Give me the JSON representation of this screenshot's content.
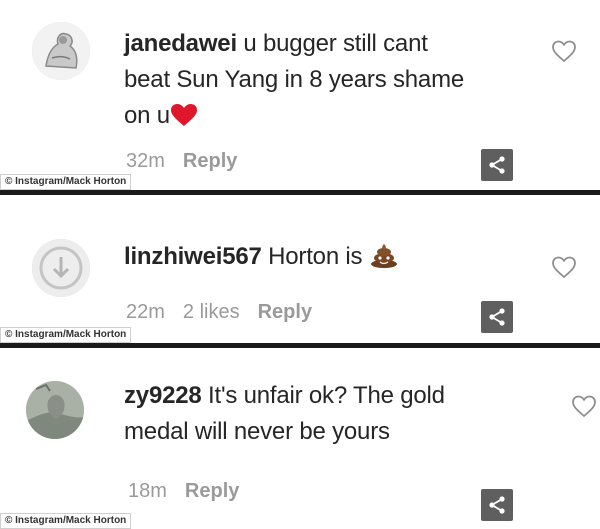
{
  "comments": [
    {
      "username": "janedawei",
      "line1": "u bugger still cant",
      "line2": "beat Sun Yang in 8 years shame",
      "line3": "on u",
      "emoji": "red-heart-icon",
      "time": "32m",
      "likes": "",
      "reply": "Reply",
      "credit": "© Instagram/Mack Horton"
    },
    {
      "username": "linzhiwei567",
      "line1": "Horton is",
      "emoji": "poop-emoji-icon",
      "time": "22m",
      "likes": "2 likes",
      "reply": "Reply",
      "credit": "© Instagram/Mack Horton"
    },
    {
      "username": "zy9228",
      "line1": "It's unfair ok? The gold",
      "line2": "medal will never be yours",
      "time": "18m",
      "likes": "",
      "reply": "Reply",
      "credit": "© Instagram/Mack Horton"
    }
  ],
  "colors": {
    "text": "#262626",
    "meta": "#9a9a9a",
    "heart_emoji": "#e0162b",
    "share_bg": "#5f5f5f"
  }
}
